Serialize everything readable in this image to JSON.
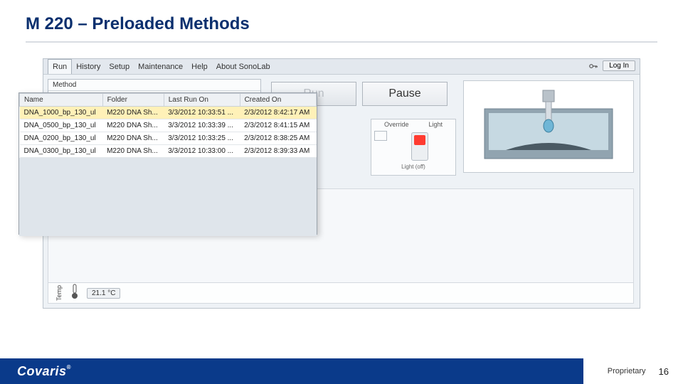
{
  "slide": {
    "title": "M 220 – Preloaded Methods",
    "proprietary": "Proprietary",
    "page": "16",
    "brand": "Covaris"
  },
  "menubar": {
    "items": [
      "Run",
      "History",
      "Setup",
      "Maintenance",
      "Help",
      "About SonoLab"
    ],
    "login": "Log In"
  },
  "panel": {
    "method_label": "Method"
  },
  "buttons": {
    "run": "Run",
    "pause": "Pause"
  },
  "controls": {
    "override": "Override",
    "light": "Light",
    "lightoff": "Light (off)"
  },
  "temp": {
    "label": "Temp",
    "value": "21.1 °C"
  },
  "browser": {
    "columns": [
      "Name",
      "Folder",
      "Last Run On",
      "Created On"
    ],
    "rows": [
      {
        "name": "DNA_1000_bp_130_ul",
        "folder": "M220 DNA Sh...",
        "last": "3/3/2012 10:33:51 ...",
        "created": "2/3/2012 8:42:17 AM"
      },
      {
        "name": "DNA_0500_bp_130_ul",
        "folder": "M220 DNA Sh...",
        "last": "3/3/2012 10:33:39 ...",
        "created": "2/3/2012 8:41:15 AM"
      },
      {
        "name": "DNA_0200_bp_130_ul",
        "folder": "M220 DNA Sh...",
        "last": "3/3/2012 10:33:25 ...",
        "created": "2/3/2012 8:38:25 AM"
      },
      {
        "name": "DNA_0300_bp_130_ul",
        "folder": "M220 DNA Sh...",
        "last": "3/3/2012 10:33:00 ...",
        "created": "2/3/2012 8:39:33 AM"
      }
    ]
  }
}
